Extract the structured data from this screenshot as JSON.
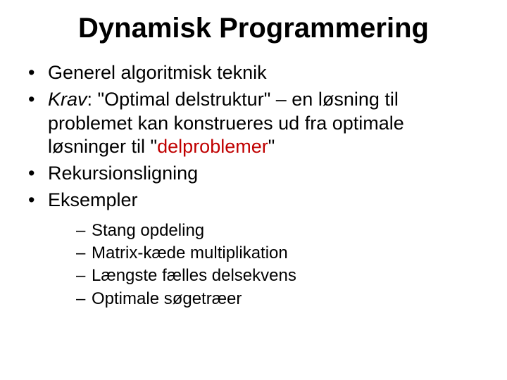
{
  "title": "Dynamisk Programmering",
  "bullets": {
    "b1": "Generel algoritmisk teknik",
    "b2_label": "Krav",
    "b2_rest_a": ": \"Optimal delstruktur\" – en løsning til problemet kan konstrueres ud fra optimale løsninger til \"",
    "b2_highlight": "delproblemer",
    "b2_rest_b": "\"",
    "b3": "Rekursionsligning",
    "b4": "Eksempler",
    "sub": {
      "s1": "Stang opdeling",
      "s2": "Matrix-kæde multiplikation",
      "s3": "Længste fælles delsekvens",
      "s4": "Optimale søgetræer"
    }
  }
}
